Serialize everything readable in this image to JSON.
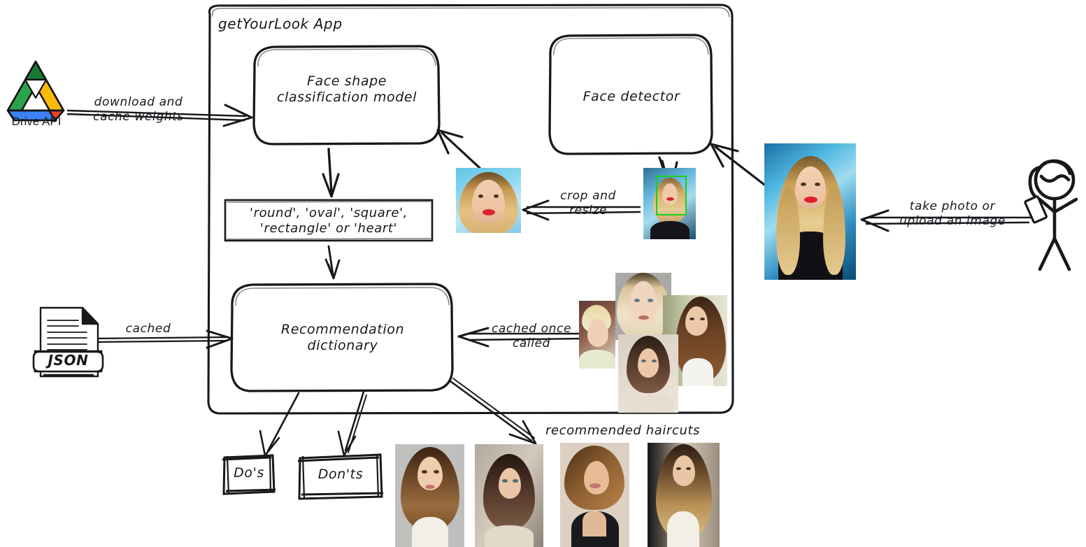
{
  "diagram": {
    "container_title": "getYourLook App",
    "nodes": {
      "face_shape_model": "Face shape\nclassification model",
      "face_detector": "Face detector",
      "classes": "'round', 'oval', 'square',\n'rectangle' or 'heart'",
      "recommendation_dictionary": "Recommendation\ndictionary",
      "dos": "Do's",
      "donts": "Don'ts"
    },
    "external": {
      "drive_api": "Drive API",
      "json_file": "JSON"
    },
    "edges": {
      "download_cache": "download and\ncache weights",
      "cached": "cached",
      "crop_resize": "crop and\nresize",
      "cached_once_called": "cached once\ncalled",
      "take_photo": "take photo or\nupload an image"
    },
    "captions": {
      "recommended_haircuts": "recommended haircuts"
    },
    "colors": {
      "stroke": "#16181c",
      "background": "#ffffff",
      "detection_box": "#19d219",
      "drive_green": "#2ba24c",
      "drive_dark_green": "#1a7a35",
      "drive_yellow": "#fbba07",
      "drive_blue": "#3b82f6",
      "drive_dark_blue": "#1668d4",
      "drive_red": "#e8402a"
    },
    "images": {
      "cropped_face": "cropped-face-thumbnail",
      "detected_face": "detected-face-with-bounding-box",
      "user_portrait": "user-portrait-photo",
      "hairstyle_collage": [
        "hairstyle-blonde-updo",
        "hairstyle-straight-blonde",
        "hairstyle-long-brunette-bangs",
        "hairstyle-bob-bangs"
      ],
      "recommended_haircuts": [
        "haircut-long-layered",
        "haircut-shaggy-bob",
        "haircut-short-textured",
        "haircut-long-wavy"
      ]
    }
  }
}
